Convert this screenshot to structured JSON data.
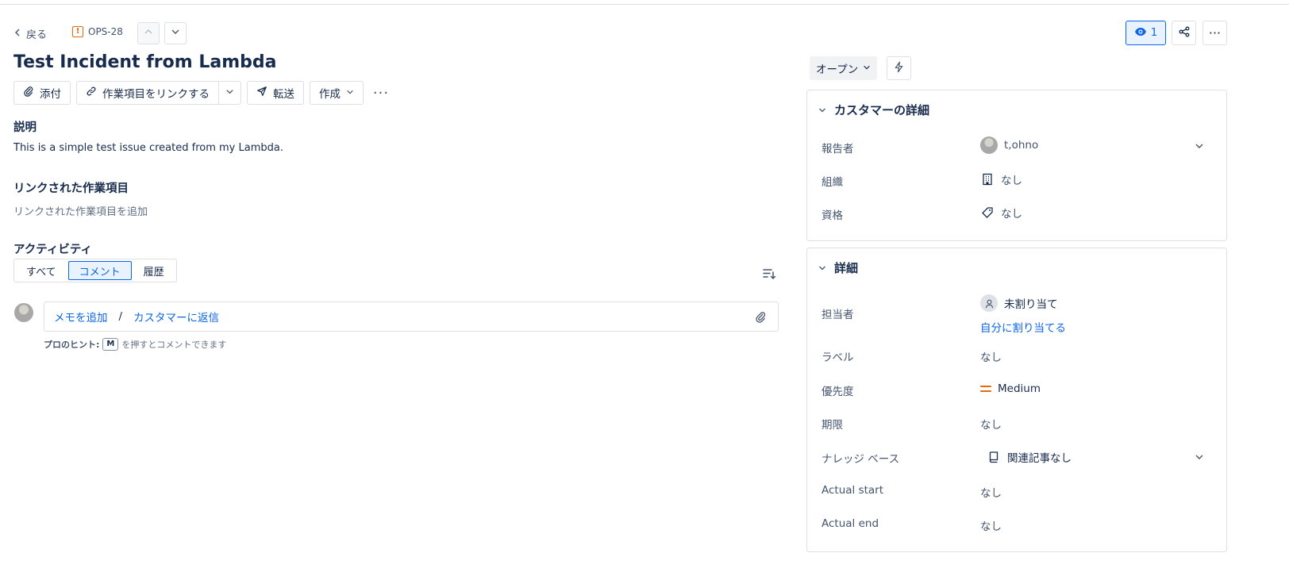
{
  "nav": {
    "back_label": "戻る",
    "issue_key": "OPS-28",
    "issue_type_glyph": "!"
  },
  "issue": {
    "title": "Test Incident from Lambda"
  },
  "toolbar": {
    "attach_label": "添付",
    "link_label": "作業項目をリンクする",
    "forward_label": "転送",
    "create_label": "作成",
    "more_label": "···"
  },
  "description": {
    "heading": "説明",
    "text": "This is a simple test issue created from my Lambda."
  },
  "linked": {
    "heading": "リンクされた作業項目",
    "placeholder": "リンクされた作業項目を追加"
  },
  "activity": {
    "heading": "アクティビティ",
    "tabs": [
      {
        "label": "すべて",
        "active": false
      },
      {
        "label": "コメント",
        "active": true
      },
      {
        "label": "履歴",
        "active": false
      }
    ],
    "comment": {
      "add_note": "メモを追加",
      "separator": "/",
      "reply_customer": "カスタマーに返信"
    },
    "hint": {
      "prefix": "プロのヒント:",
      "key": "M",
      "suffix": "を押すとコメントできます"
    }
  },
  "header_right": {
    "watch_count": "1",
    "more_label": "···"
  },
  "status": {
    "label": "オープン"
  },
  "customer_panel": {
    "heading": "カスタマーの詳細",
    "rows": [
      {
        "label": "報告者",
        "value": "t,ohno"
      },
      {
        "label": "組織",
        "value": "なし"
      },
      {
        "label": "資格",
        "value": "なし"
      }
    ]
  },
  "details_panel": {
    "heading": "詳細",
    "assignee": {
      "label": "担当者",
      "value": "未割り当て",
      "assign_me": "自分に割り当てる"
    },
    "rows": [
      {
        "label": "ラベル",
        "value": "なし"
      },
      {
        "label": "優先度",
        "value": "Medium"
      },
      {
        "label": "期限",
        "value": "なし"
      },
      {
        "label": "ナレッジ ベース",
        "value": "関連記事なし"
      },
      {
        "label": "Actual start",
        "value": "なし"
      },
      {
        "label": "Actual end",
        "value": "なし"
      }
    ]
  },
  "colors": {
    "link": "#0c66e4",
    "priority_medium": "#e56910",
    "text": "#172b4d",
    "subtle": "#44546f"
  }
}
